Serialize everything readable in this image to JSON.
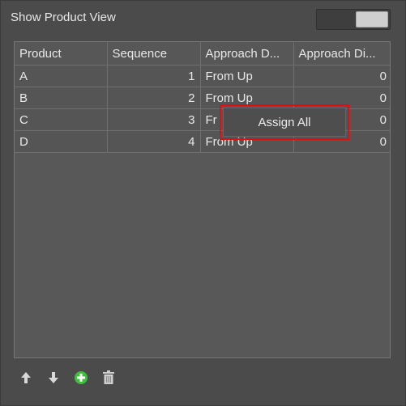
{
  "header": {
    "title": "Show Product View"
  },
  "table": {
    "columns": [
      "Product",
      "Sequence",
      "Approach D...",
      "Approach Di..."
    ],
    "rows": [
      {
        "product": "A",
        "sequence": "1",
        "approach_dir": "From Up",
        "approach_dist": "0"
      },
      {
        "product": "B",
        "sequence": "2",
        "approach_dir": "From Up",
        "approach_dist": "0"
      },
      {
        "product": "C",
        "sequence": "3",
        "approach_dir": "Fr",
        "approach_dist": "0"
      },
      {
        "product": "D",
        "sequence": "4",
        "approach_dir": "From Up",
        "approach_dist": "0"
      }
    ]
  },
  "context_menu": {
    "item_label": "Assign All"
  },
  "toolbar": {
    "icons": [
      "arrow-up-icon",
      "arrow-down-icon",
      "add-icon",
      "trash-icon"
    ],
    "add_color": "#3fbf3f"
  }
}
